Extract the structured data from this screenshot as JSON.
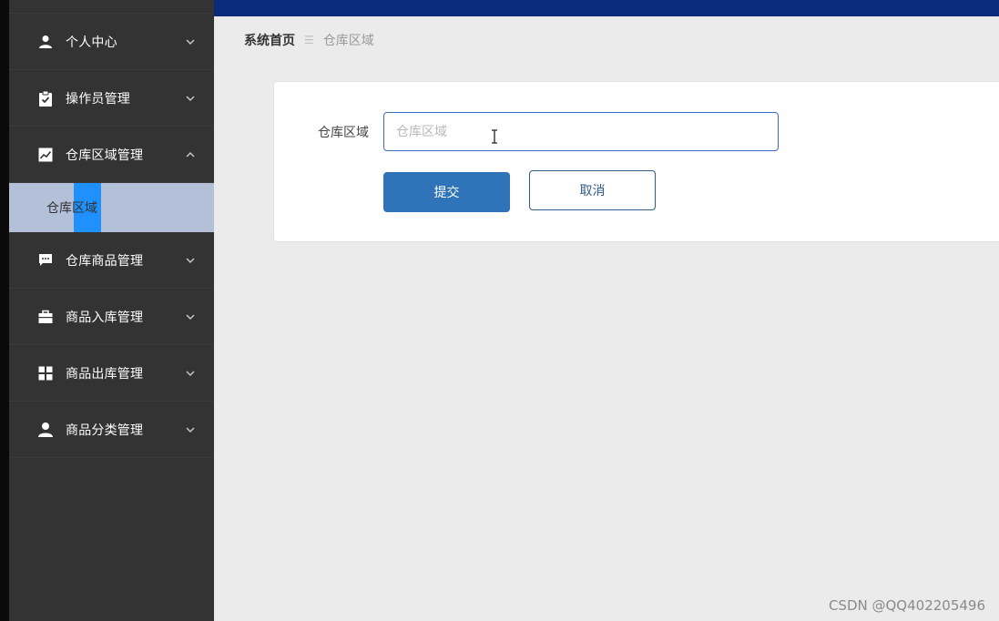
{
  "sidebar": {
    "items": [
      {
        "label": "个人中心",
        "icon": "user-icon",
        "expanded": false
      },
      {
        "label": "操作员管理",
        "icon": "clipboard-icon",
        "expanded": false
      },
      {
        "label": "仓库区域管理",
        "icon": "chart-icon",
        "expanded": true,
        "children": [
          {
            "label": "仓库区域",
            "active": true
          }
        ]
      },
      {
        "label": "仓库商品管理",
        "icon": "chat-icon",
        "expanded": false
      },
      {
        "label": "商品入库管理",
        "icon": "briefcase-icon",
        "expanded": false
      },
      {
        "label": "商品出库管理",
        "icon": "grid-icon",
        "expanded": false
      },
      {
        "label": "商品分类管理",
        "icon": "person-icon",
        "expanded": false
      }
    ]
  },
  "breadcrumb": {
    "home": "系统首页",
    "separator": "☰",
    "current": "仓库区域"
  },
  "form": {
    "field_label": "仓库区域",
    "field_value": "",
    "field_placeholder": "仓库区域",
    "submit_label": "提交",
    "cancel_label": "取消"
  },
  "watermark": "CSDN @QQ402205496",
  "colors": {
    "sidebar_bg": "#333333",
    "topbar": "#0b2a7a",
    "submenu_bg": "#b3c0d8",
    "submenu_highlight": "#1e90ff",
    "primary_button": "#2f73b9"
  }
}
